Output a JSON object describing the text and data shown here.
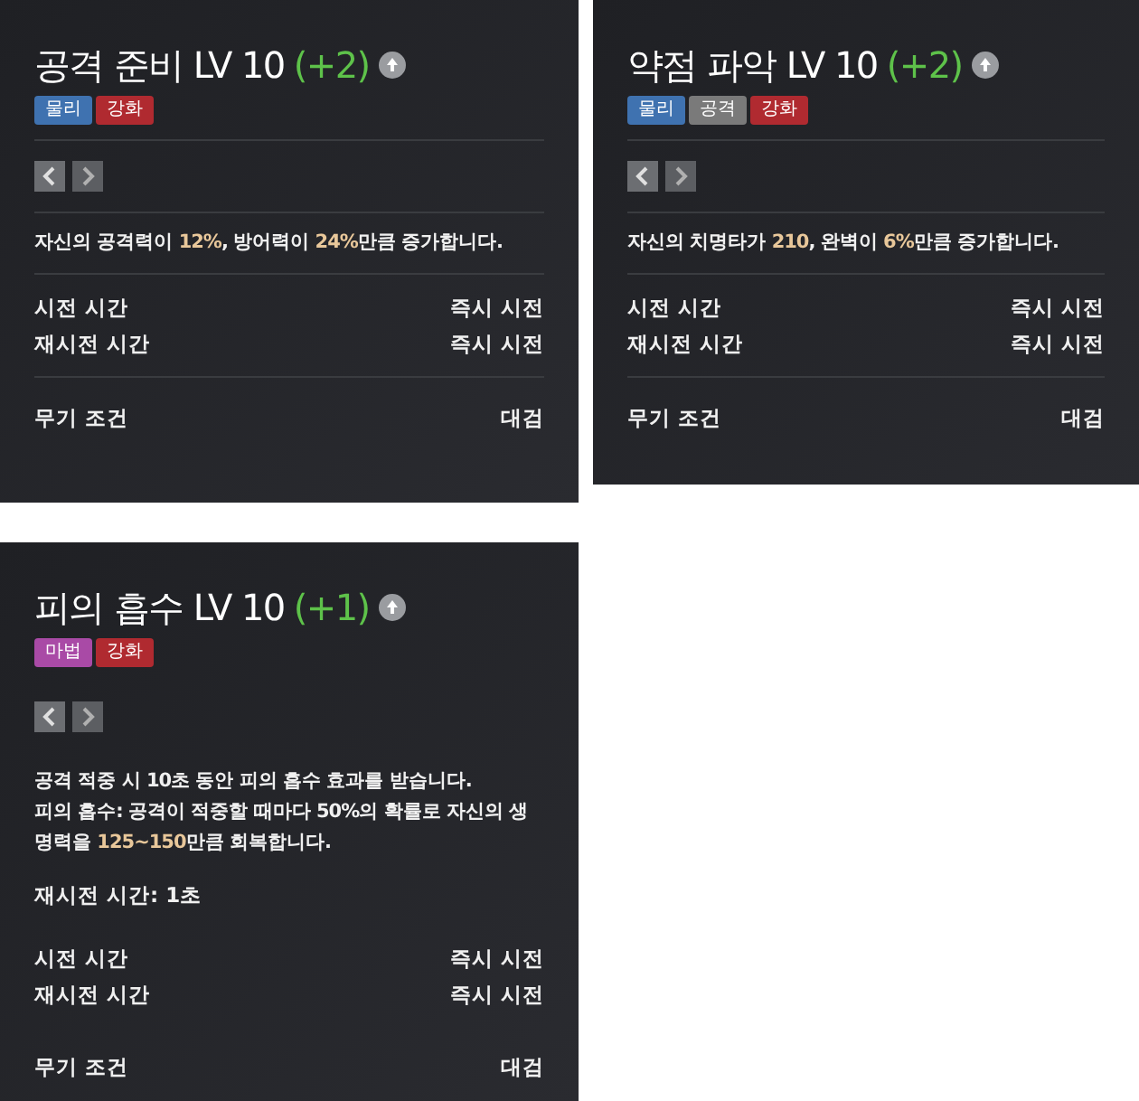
{
  "cards": [
    {
      "title": "공격 준비 LV 10",
      "bonus": "(+2)",
      "tags": [
        {
          "label": "물리",
          "color": "#3f72b0"
        },
        {
          "label": "강화",
          "color": "#b02a30"
        }
      ],
      "description": [
        [
          {
            "text": "자신의 공격력이 "
          },
          {
            "text": "12%",
            "highlight": true
          },
          {
            "text": ", 방어력이 "
          },
          {
            "text": "24%",
            "highlight": true
          },
          {
            "text": "만큼 증가합니다."
          }
        ]
      ],
      "stats": [
        {
          "label": "시전 시간",
          "value": "즉시 시전"
        },
        {
          "label": "재시전 시간",
          "value": "즉시 시전"
        }
      ],
      "weapon": {
        "label": "무기 조건",
        "value": "대검"
      }
    },
    {
      "title": "약점 파악 LV 10",
      "bonus": "(+2)",
      "tags": [
        {
          "label": "물리",
          "color": "#3f72b0"
        },
        {
          "label": "공격",
          "color": "#7a7a7a"
        },
        {
          "label": "강화",
          "color": "#b02a30"
        }
      ],
      "description": [
        [
          {
            "text": "자신의 치명타가 "
          },
          {
            "text": "210",
            "highlight": true
          },
          {
            "text": ", 완벽이 "
          },
          {
            "text": "6%",
            "highlight": true
          },
          {
            "text": "만큼 증가합니다."
          }
        ]
      ],
      "stats": [
        {
          "label": "시전 시간",
          "value": "즉시 시전"
        },
        {
          "label": "재시전 시간",
          "value": "즉시 시전"
        }
      ],
      "weapon": {
        "label": "무기 조건",
        "value": "대검"
      }
    },
    {
      "title": "피의 흡수 LV 10",
      "bonus": "(+1)",
      "tags": [
        {
          "label": "마법",
          "color": "#a94aa6"
        },
        {
          "label": "강화",
          "color": "#b02a30"
        }
      ],
      "description": [
        [
          {
            "text": "공격 적중 시 10초 동안 피의 흡수 효과를 받습니다."
          }
        ],
        [
          {
            "text": "피의 흡수: 공격이 적중할 때마다 50%의 확률로 자신의 생명력을 "
          },
          {
            "text": "125~150",
            "highlight": true
          },
          {
            "text": "만큼 회복합니다."
          }
        ]
      ],
      "note": "재시전 시간: 1초",
      "stats": [
        {
          "label": "시전 시간",
          "value": "즉시 시전"
        },
        {
          "label": "재시전 시간",
          "value": "즉시 시전"
        }
      ],
      "weapon": {
        "label": "무기 조건",
        "value": "대검"
      }
    }
  ]
}
